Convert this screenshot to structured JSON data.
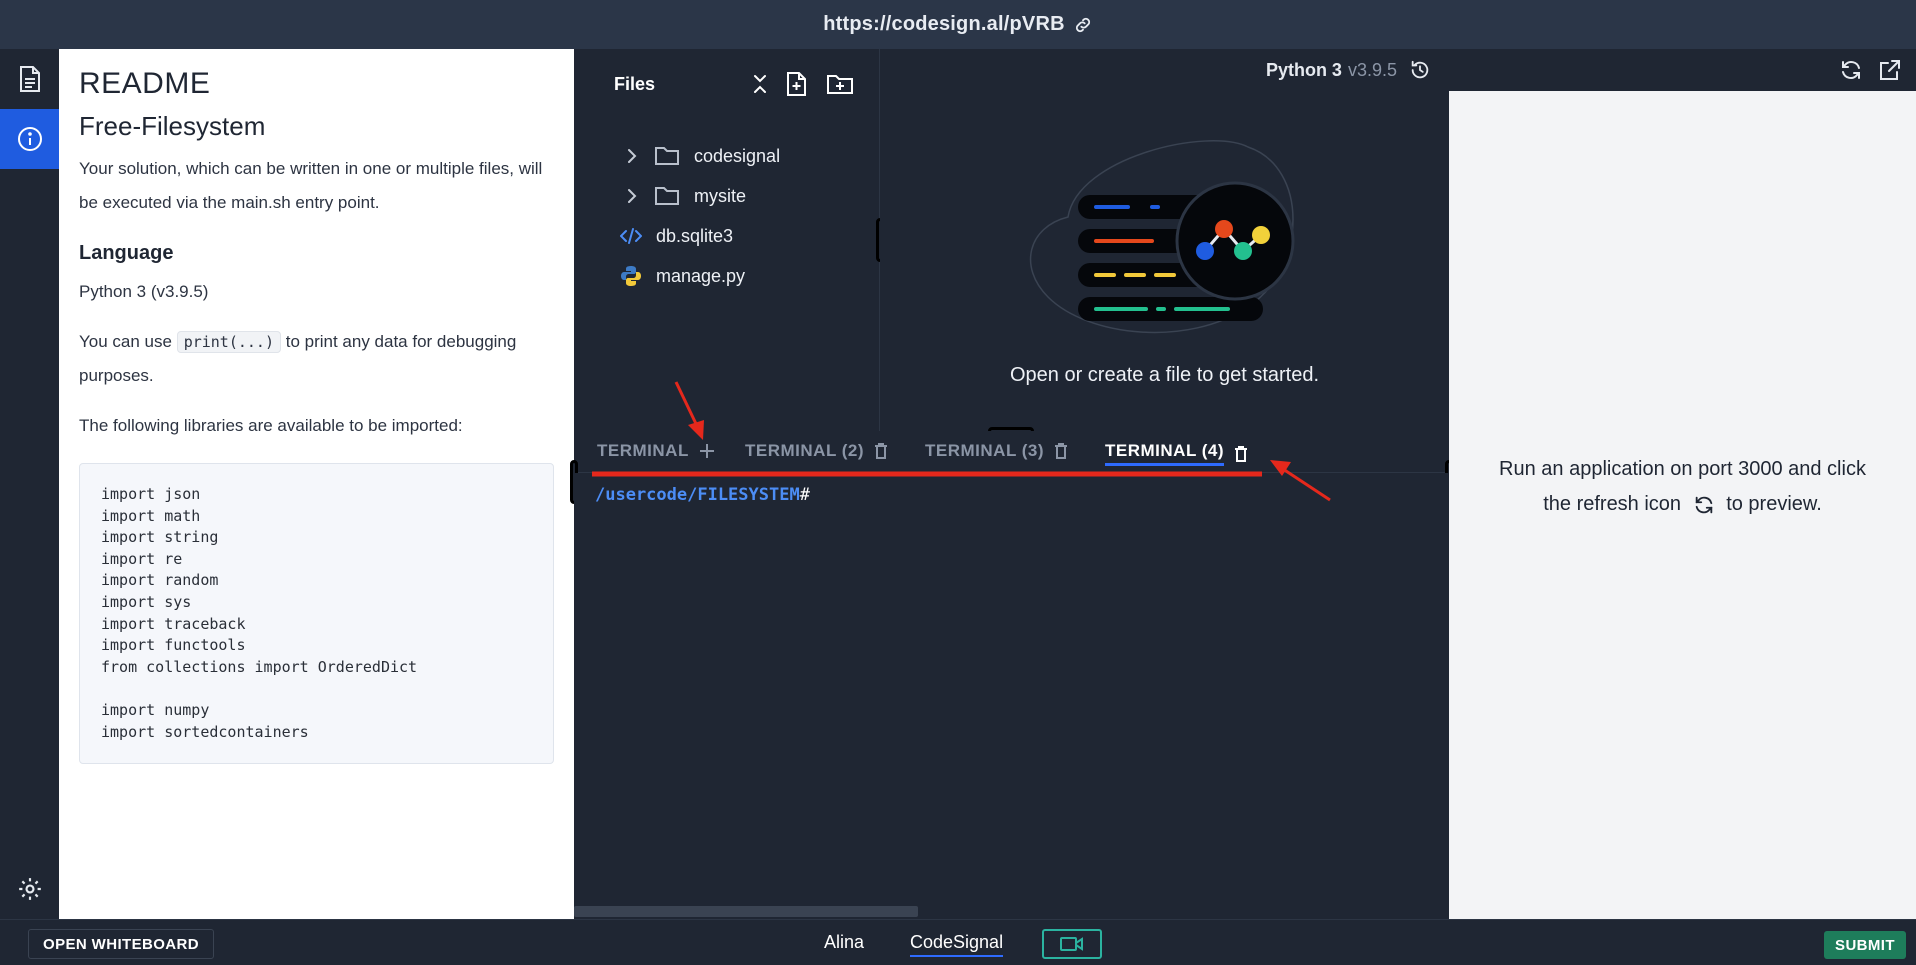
{
  "url": "https://codesign.al/pVRB",
  "readme": {
    "title": "README",
    "subtitle": "Free-Filesystem",
    "intro": "Your solution, which can be written in one or multiple files, will be executed via the main.sh entry point.",
    "language_heading": "Language",
    "language_value": "Python 3 (v3.9.5)",
    "print_before": "You can use ",
    "print_code": "print(...)",
    "print_after": " to print any data for debugging purposes.",
    "libraries_intro": "The following libraries are available to be imported:",
    "code": "import json\nimport math\nimport string\nimport re\nimport random\nimport sys\nimport traceback\nimport functools\nfrom collections import OrderedDict\n\nimport numpy\nimport sortedcontainers"
  },
  "files": {
    "heading": "Files",
    "items": [
      {
        "label": "codesignal",
        "type": "folder"
      },
      {
        "label": "mysite",
        "type": "folder"
      },
      {
        "label": "db.sqlite3",
        "type": "code"
      },
      {
        "label": "manage.py",
        "type": "python"
      }
    ]
  },
  "editor": {
    "language": "Python 3",
    "version": "v3.9.5",
    "empty_message": "Open or create a file to get started."
  },
  "terminal": {
    "tabs": [
      {
        "label": "TERMINAL",
        "icon": "plus-icon"
      },
      {
        "label": "TERMINAL (2)",
        "icon": "trash-icon"
      },
      {
        "label": "TERMINAL (3)",
        "icon": "trash-icon"
      },
      {
        "label": "TERMINAL (4)",
        "icon": "trash-icon",
        "active": true
      }
    ],
    "prompt_path": "/usercode/FILESYSTEM",
    "prompt_symbol": "#"
  },
  "preview": {
    "message_before": "Run an application on port 3000 and click the refresh icon",
    "message_after": "to preview."
  },
  "bottom": {
    "whiteboard_label": "OPEN WHITEBOARD",
    "users": [
      "Alina",
      "CodeSignal"
    ],
    "submit_label": "SUBMIT"
  },
  "colors": {
    "accent": "#1f5ce0",
    "annotation": "#e5281c",
    "submit": "#1e7d5b",
    "terminal_path": "#4c8df6"
  }
}
